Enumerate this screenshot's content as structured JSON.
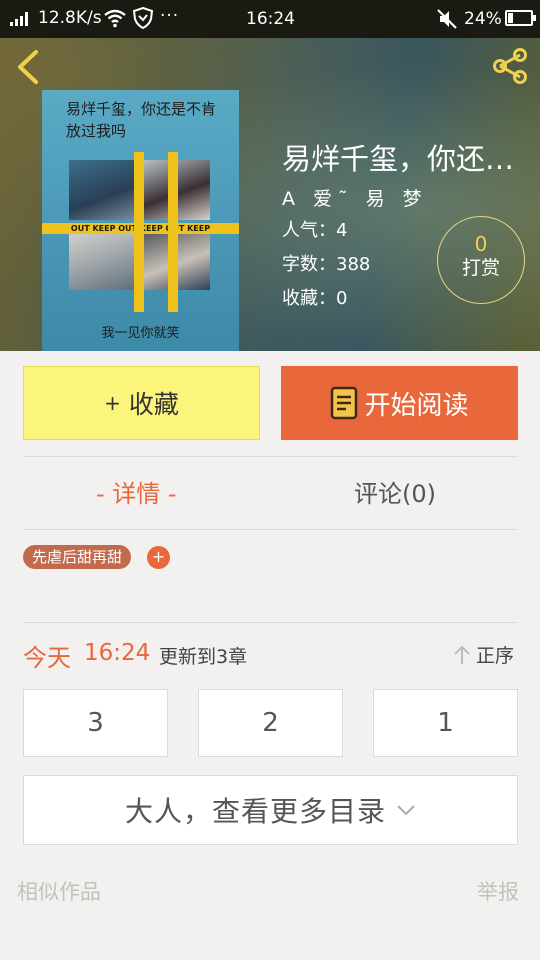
{
  "status_bar": {
    "net_speed": "12.8K/s",
    "more": "···",
    "time": "16:24",
    "battery": "24%",
    "battery_level": 0.24
  },
  "header": {
    "cover": {
      "title": "易烊千玺，你还是不肯放过我吗",
      "tape_text": "OUT KEEP OUT KEEP OUT KEEP",
      "caption": "我一见你就笑"
    },
    "title": "易烊千玺，你还…",
    "author": "A 爱˜ 易 梦",
    "popularity_label": "人气：",
    "popularity_value": "4",
    "words_label": "字数：",
    "words_value": "388",
    "favorites_label": "收藏：",
    "favorites_value": "0",
    "tip": {
      "count": "0",
      "label": "打赏"
    }
  },
  "actions": {
    "collect_plus": "+",
    "collect_label": "收藏",
    "read_label": "开始阅读"
  },
  "tabs": {
    "detail": "- 详情 -",
    "comments": "评论(0)"
  },
  "tags": {
    "items": [
      "先虐后甜再甜"
    ],
    "add": "+"
  },
  "updates": {
    "today": "今天",
    "time": "16:24",
    "text": "更新到3章",
    "sort_label": "正序"
  },
  "chapters": [
    "3",
    "2",
    "1"
  ],
  "more_catalog": "大人，查看更多目录",
  "footer": {
    "similar": "相似作品",
    "report": "举报"
  },
  "colors": {
    "accent": "#e8683c",
    "collect_button": "#fbf57c",
    "tip_count": "#f1cf5e"
  }
}
